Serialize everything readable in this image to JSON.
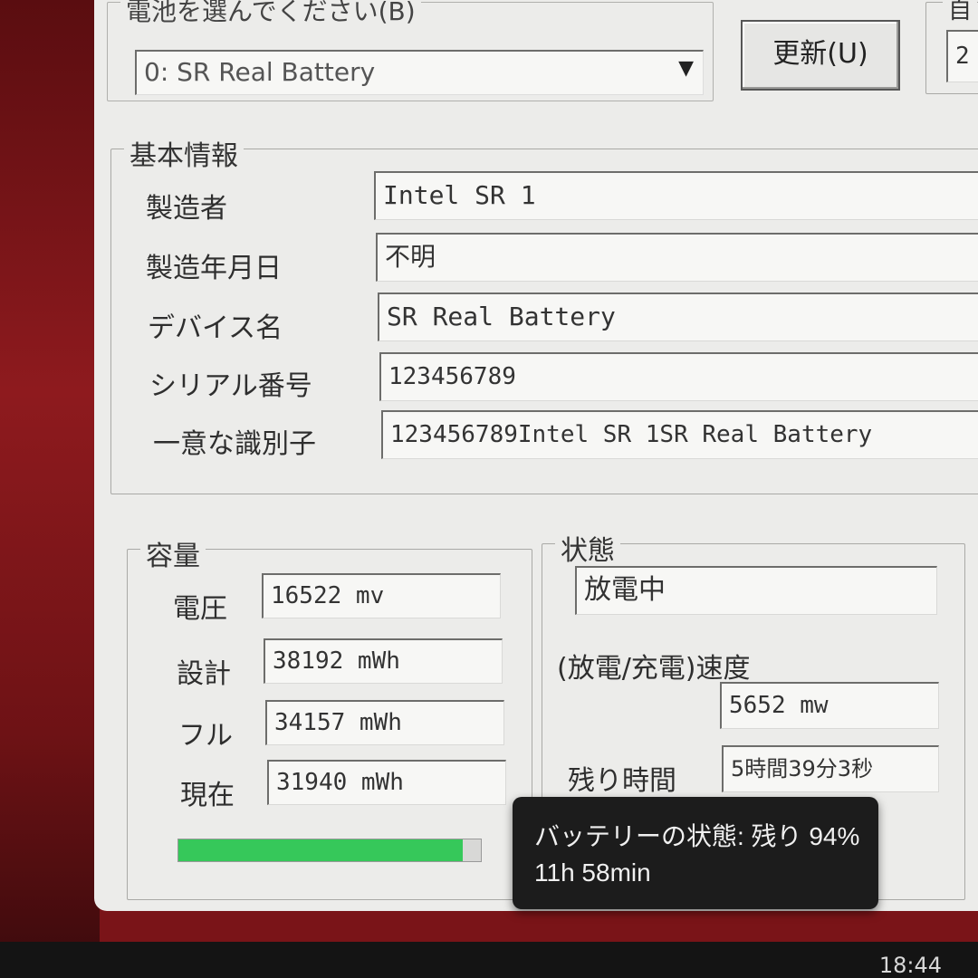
{
  "battery_select": {
    "group_label": "電池を選んでください(B)",
    "selected": "0: SR Real Battery"
  },
  "update_button": "更新(U)",
  "right_partial": {
    "label_fragment": "自",
    "value_fragment": "2"
  },
  "basic_info": {
    "title": "基本情報",
    "rows": [
      {
        "label": "製造者",
        "value": "Intel SR 1"
      },
      {
        "label": "製造年月日",
        "value": "不明"
      },
      {
        "label": "デバイス名",
        "value": "SR Real Battery"
      },
      {
        "label": "シリアル番号",
        "value": "123456789"
      },
      {
        "label": "一意な識別子",
        "value": "123456789Intel SR 1SR Real Battery"
      }
    ]
  },
  "capacity": {
    "title": "容量",
    "rows": [
      {
        "label": "電圧",
        "value": "16522 mv"
      },
      {
        "label": "設計",
        "value": "38192 mWh"
      },
      {
        "label": "フル",
        "value": "34157 mWh"
      },
      {
        "label": "現在",
        "value": "31940 mWh"
      }
    ],
    "charge_fraction": 0.94
  },
  "status": {
    "title": "状態",
    "state": "放電中",
    "rate_label": "(放電/充電)速度",
    "rate_value": "5652 mw",
    "remaining_label": "残り時間",
    "remaining_value": "5時間39分3秒"
  },
  "tooltip": {
    "line1": "バッテリーの状態: 残り 94%",
    "line2": "11h 58min"
  },
  "taskbar": {
    "time": "18:44"
  },
  "colors": {
    "progress": "#36c85a",
    "window": "#ececea",
    "desktop": "#7a1418"
  }
}
